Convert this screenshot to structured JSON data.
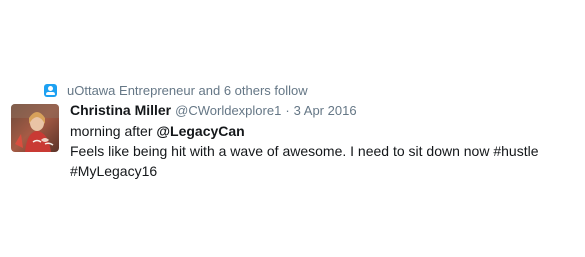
{
  "context": {
    "icon": "follow-person-icon",
    "text": "uOttawa Entrepreneur and 6 others follow",
    "icon_color": "#1da1f2"
  },
  "tweet": {
    "avatar": "profile-photo-avatar",
    "fullname": "Christina Miller",
    "username": "@CWorldexplore1",
    "separator": "·",
    "timestamp": "3 Apr 2016",
    "line1_text": "morning after ",
    "line1_mention": "@LegacyCan",
    "line2_text": "Feels like being hit with a wave of awesome. I need to sit down now ",
    "line2_hashtag": "#hustle",
    "line3_hashtag": "#MyLegacy16"
  },
  "colors": {
    "text": "#14171a",
    "secondary": "#657786",
    "accent": "#1da1f2"
  }
}
